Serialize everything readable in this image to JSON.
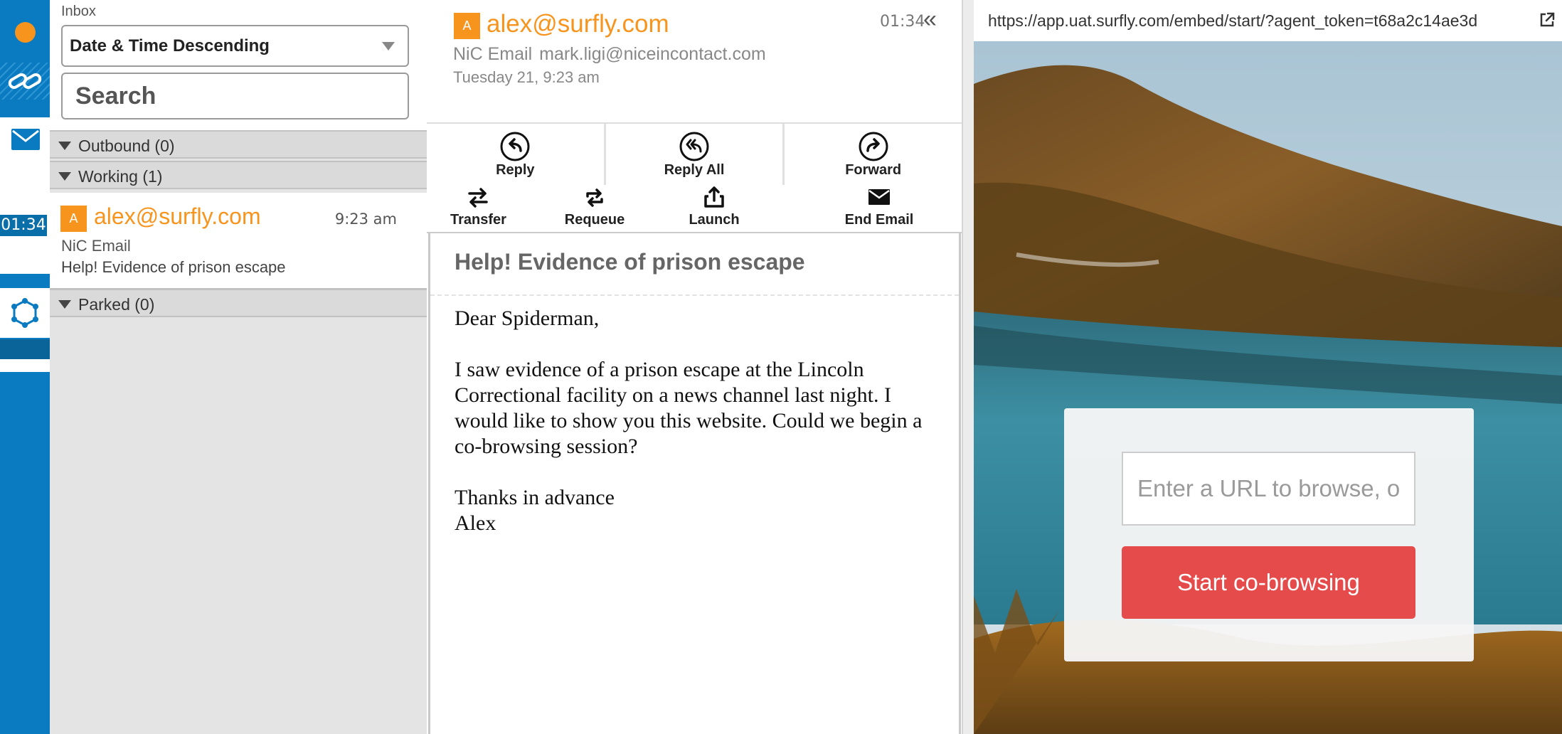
{
  "rail": {
    "timer": "01:34"
  },
  "inbox": {
    "label": "Inbox",
    "sort_value": "Date & Time Descending",
    "search_placeholder": "Search",
    "groups": [
      {
        "label": "Outbound (0)"
      },
      {
        "label": "Working (1)"
      },
      {
        "label": "Parked (0)"
      }
    ],
    "item": {
      "avatar": "A",
      "from": "alex@surfly.com",
      "time": "9:23 am",
      "channel": "NiC Email",
      "subject": "Help! Evidence of prison escape"
    }
  },
  "detail": {
    "avatar": "A",
    "from": "alex@surfly.com",
    "clock": "01:34",
    "channel": "NiC Email",
    "to_address": "mark.ligi@niceincontact.com",
    "date": "Tuesday 21, 9:23 am",
    "actions_primary": [
      {
        "label": "Reply",
        "icon": "reply-icon"
      },
      {
        "label": "Reply All",
        "icon": "reply-all-icon"
      },
      {
        "label": "Forward",
        "icon": "forward-icon"
      }
    ],
    "actions_secondary": [
      {
        "label": "Transfer",
        "icon": "transfer-icon"
      },
      {
        "label": "Requeue",
        "icon": "requeue-icon"
      },
      {
        "label": "Launch",
        "icon": "launch-icon"
      },
      {
        "label": "End Email",
        "icon": "envelope-icon"
      }
    ],
    "subject": "Help! Evidence of prison escape",
    "body": {
      "greeting": "Dear Spiderman,",
      "paragraph": "I saw evidence of a prison escape at the Lincoln Correctional facility on a news channel last night. I would like to show you this website. Could we begin a co-browsing session?",
      "closing": "Thanks in advance",
      "signature": "Alex"
    }
  },
  "browser": {
    "url": "https://app.uat.surfly.com/embed/start/?agent_token=t68a2c14ae3d",
    "url_placeholder": "Enter a URL to browse, or a",
    "start_label": "Start co-browsing"
  },
  "colors": {
    "rail_blue": "#0a7bc1",
    "accent_orange": "#f7941d",
    "start_button_red": "#e64b4b"
  }
}
